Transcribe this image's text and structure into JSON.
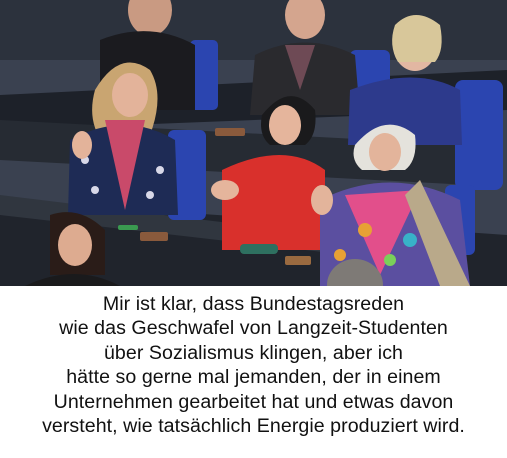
{
  "caption": {
    "lines": [
      "Mir ist klar, dass Bundestagsreden",
      "wie das Geschwafel von Langzeit-Studenten",
      "über Sozialismus klingen, aber ich",
      "hätte so gerne mal jemanden, der in einem",
      "Unternehmen gearbeitet hat und etwas davon",
      "versteht, wie tatsächlich Energie produziert wird."
    ]
  },
  "colors": {
    "background": "#ffffff",
    "caption_text": "#111111",
    "seat_blue": "#2b45b0",
    "desk_dark": "#2a2f38",
    "red_top": "#d9302c"
  },
  "photo": {
    "scene": "parliament-session-photo"
  }
}
